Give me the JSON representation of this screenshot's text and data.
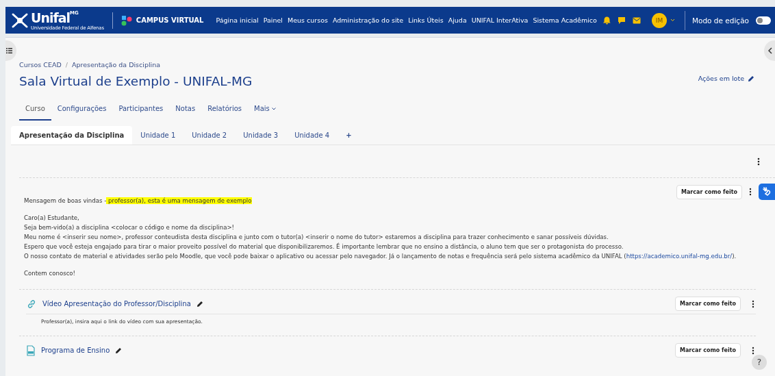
{
  "navbar": {
    "logo": "Unifal",
    "logo_suffix": "MG",
    "logo_caption": "Universidade Federal de Alfenas",
    "brand": "CAMPUS VIRTUAL",
    "links": [
      "Página inicial",
      "Painel",
      "Meus cursos",
      "Administração do site",
      "Links Úteis",
      "Ajuda",
      "UNIFAL InterAtiva",
      "Sistema Acadêmico"
    ],
    "avatar": "IM",
    "edit_mode": {
      "label": "Modo de edição",
      "on": false
    }
  },
  "breadcrumb": [
    "Cursos CEAD",
    "Apresentação da Disciplina"
  ],
  "breadcrumb_separator": "/",
  "course_title": "Sala Virtual de Exemplo - UNIFAL-MG",
  "bulk_actions": "Ações em lote",
  "secondary_nav": [
    {
      "label": "Curso",
      "selected": true
    },
    {
      "label": "Configurações",
      "selected": false
    },
    {
      "label": "Participantes",
      "selected": false
    },
    {
      "label": "Notas",
      "selected": false
    },
    {
      "label": "Relatórios",
      "selected": false
    },
    {
      "label": "Mais",
      "selected": false,
      "dropdown": true
    }
  ],
  "section_tabs": [
    {
      "label": "Apresentação da Disciplina",
      "selected": true
    },
    {
      "label": "Unidade 1",
      "selected": false
    },
    {
      "label": "Unidade 2",
      "selected": false
    },
    {
      "label": "Unidade 3",
      "selected": false
    },
    {
      "label": "Unidade 4",
      "selected": false
    }
  ],
  "add_tab": "+",
  "welcome": {
    "button": "Marcar como feito",
    "heading": "Mensagem de boas vindas -",
    "highlight": " professor(a), esta é uma mensagem de exemplo",
    "greeting": "Caro(a) Estudante,",
    "lines": [
      "Seja bem-vido(a) a disciplina <colocar o código e nome da disciplina>!",
      "Meu nome é <inserir seu nome>, professor conteudista desta disciplina e junto com o tutor(a) <inserir o nome do tutor> estaremos a disciplina para trazer conhecimento e sanar possíveis dúvidas.",
      "Espero que você esteja engajado para tirar o maior proveito possível do material que disponibilizaremos. É importante lembrar que no ensino a distância, o aluno tem que ser o protagonista do processo."
    ],
    "last_line": {
      "before": "O nosso contato de material e atividades serão pelo Moodle, que você pode baixar o aplicativo ou acessar pelo navegador. Já o lançamento de notas e frequência será pelo sistema acadêmico da UNIFAL (",
      "link": "https://academico.unifal-mg.edu.br/",
      "after": ")."
    },
    "closing": "Contem conosco!"
  },
  "activities": [
    {
      "kind": "url",
      "title": "Vídeo Apresentação do Professor/Disciplina",
      "button": "Marcar como feito",
      "description": "Professor(a), insira aqui o link do vídeo com sua apresentação."
    },
    {
      "kind": "pdf",
      "title": "Programa de Ensino",
      "button": "Marcar como feito"
    }
  ],
  "help": "?"
}
